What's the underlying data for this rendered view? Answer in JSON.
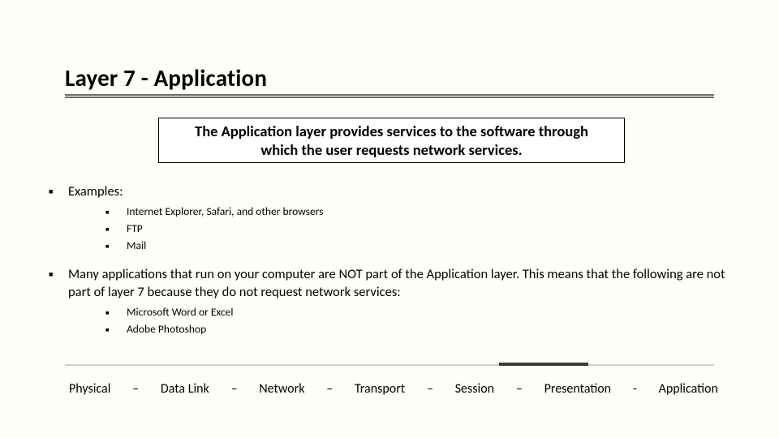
{
  "title": "Layer 7 - Application",
  "callout": "The Application layer provides services to the software through which the user requests network services.",
  "points": [
    {
      "text": "Examples:",
      "sub": [
        "Internet Explorer, Safari, and other browsers",
        "FTP",
        "Mail"
      ]
    },
    {
      "text": "Many applications that run on your computer are NOT part of the Application layer.  This means that the following are not part of  layer 7 because they do not request network services:",
      "sub": [
        "Microsoft Word or Excel",
        "Adobe Photoshop"
      ]
    }
  ],
  "footer": {
    "items": [
      "Physical",
      "Data Link",
      "Network",
      "Transport",
      "Session",
      "Presentation",
      "Application"
    ],
    "sep_dash": "–",
    "sep_bullet": "-"
  }
}
